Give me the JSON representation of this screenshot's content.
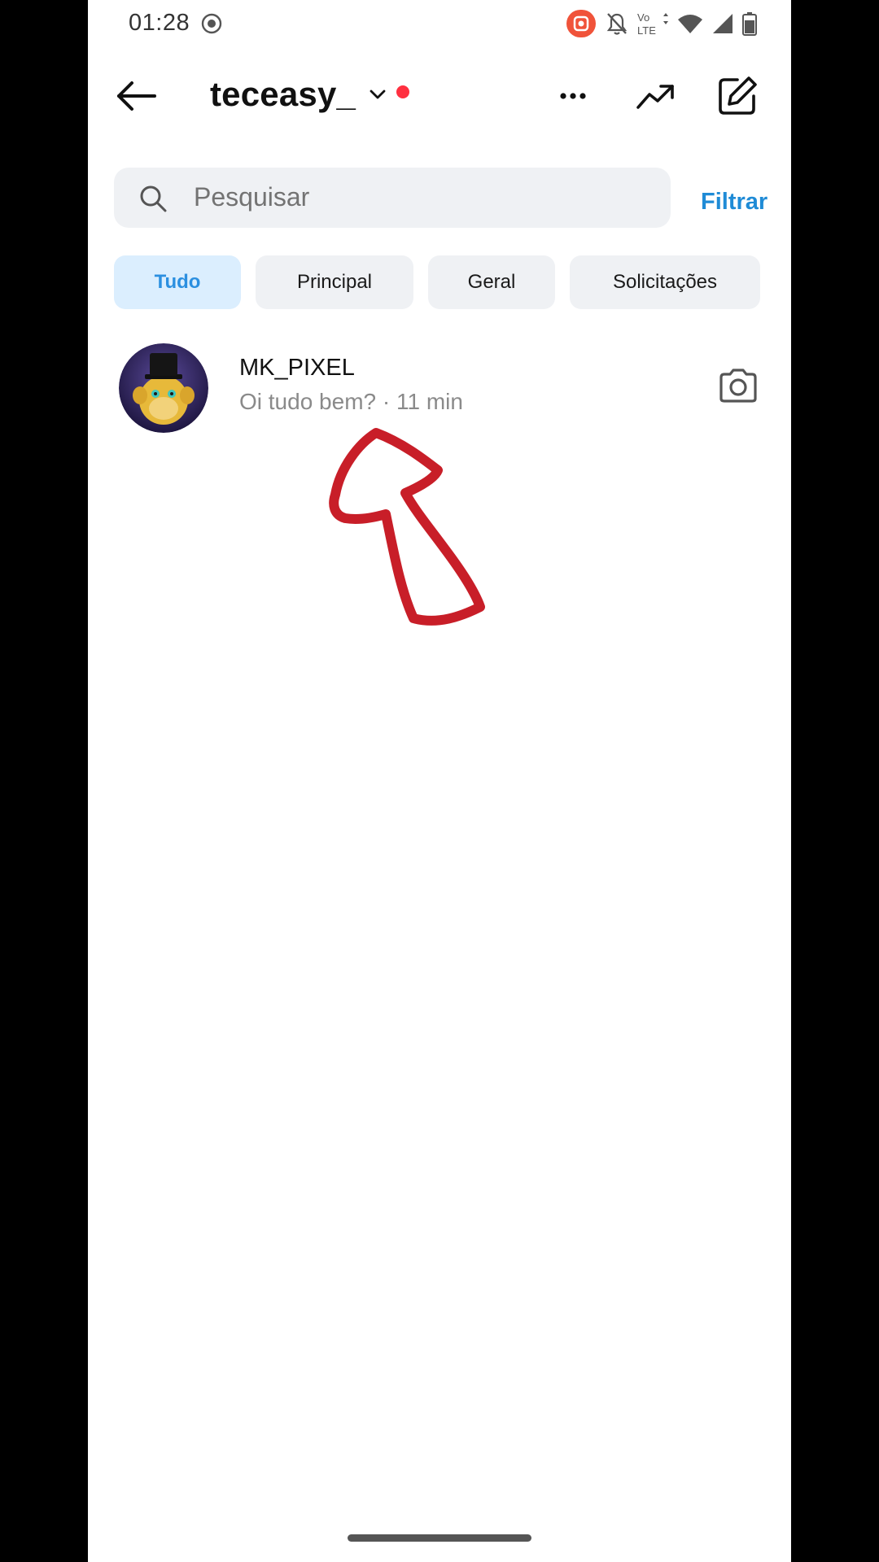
{
  "status_bar": {
    "time": "01:28",
    "network": "Vo LTE",
    "icons": [
      "screen-record-icon",
      "app-notification-icon",
      "mute-icon",
      "volte-icon",
      "wifi-icon",
      "signal-icon",
      "battery-icon"
    ],
    "app_badge_color": "#f0533a"
  },
  "header": {
    "account_name": "teceasy_",
    "icons": [
      "back-arrow-icon",
      "chevron-down-icon",
      "more-icon",
      "trending-icon",
      "compose-icon"
    ],
    "notification_dot_color": "#ff3040"
  },
  "search": {
    "placeholder": "Pesquisar",
    "filter_label": "Filtrar",
    "accent_color": "#1f8bd6"
  },
  "tabs": [
    {
      "label": "Tudo",
      "active": true
    },
    {
      "label": "Principal",
      "active": false
    },
    {
      "label": "Geral",
      "active": false
    },
    {
      "label": "Solicitações",
      "active": false
    }
  ],
  "chats": [
    {
      "name": "MK_PIXEL",
      "preview": "Oi tudo bem? · 11 min",
      "icon": "camera-icon"
    }
  ],
  "annotation": {
    "type": "hand-drawn-arrow",
    "color": "#c81e28"
  }
}
